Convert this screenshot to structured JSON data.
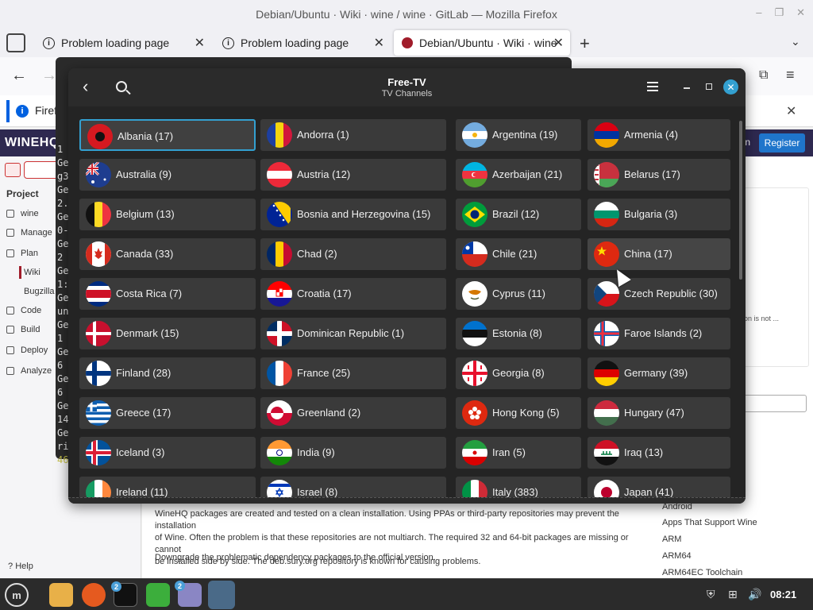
{
  "browser": {
    "window_title": "Debian/Ubuntu · Wiki · wine / wine · GitLab — Mozilla Firefox",
    "tabs": [
      {
        "label": "Problem loading page",
        "active": false
      },
      {
        "label": "Problem loading page",
        "active": false
      },
      {
        "label": "Debian/Ubuntu · Wiki · wine",
        "active": true
      }
    ],
    "notice_text": "Firef"
  },
  "gitlab": {
    "logo": "WINEHQ",
    "signin": "In",
    "register": "Register",
    "project_heading": "Project",
    "nav": [
      "wine",
      "Manage",
      "Plan",
      "Wiki",
      "Bugzilla",
      "Code",
      "Build",
      "Deploy",
      "Analyze"
    ],
    "help": "Help",
    "para1_line1": "WineHQ packages are created and tested on a clean installation. Using PPAs or third-party repositories may prevent the installation",
    "para1_line2": "of Wine. Often the problem is that these repositories are not multiarch. The required 32 and 64-bit packages are missing or cannot",
    "para1_line3": "be installed side by side. The deb.sury.org repository is known for causing problems.",
    "para2": "Downgrade the problematic dependency packages to the official version.",
    "card_text": "on is not ...",
    "right_links": [
      "Android",
      "Apps That Support Wine",
      "ARM",
      "ARM64",
      "ARM64EC Toolchain"
    ]
  },
  "terminal": {
    "chars": [
      "1",
      "Ge",
      "g3",
      "Ge",
      "2.",
      "Ge",
      "0-",
      "Ge",
      "2",
      "Ge",
      "1:",
      "Ge",
      "un",
      "Ge",
      "1",
      "Ge",
      "6",
      "Ge",
      "6",
      "Ge",
      "14",
      "Ge",
      "ri",
      "46"
    ]
  },
  "freetv": {
    "title": "Free-TV",
    "subtitle": "TV Channels",
    "selected": "Albania (17)",
    "hovered": "China (17)",
    "rows": [
      [
        "Albania (17)",
        "Andorra (1)",
        "Argentina (19)",
        "Armenia (4)"
      ],
      [
        "Australia (9)",
        "Austria (12)",
        "Azerbaijan (21)",
        "Belarus (17)"
      ],
      [
        "Belgium (13)",
        "Bosnia and Herzegovina (15)",
        "Brazil (12)",
        "Bulgaria (3)"
      ],
      [
        "Canada (33)",
        "Chad (2)",
        "Chile (21)",
        "China (17)"
      ],
      [
        "Costa Rica (7)",
        "Croatia (17)",
        "Cyprus (11)",
        "Czech Republic (30)"
      ],
      [
        "Denmark (15)",
        "Dominican Republic (1)",
        "Estonia (8)",
        "Faroe Islands (2)"
      ],
      [
        "Finland (28)",
        "France (25)",
        "Georgia (8)",
        "Germany (39)"
      ],
      [
        "Greece (17)",
        "Greenland (2)",
        "Hong Kong (5)",
        "Hungary (47)"
      ],
      [
        "Iceland (3)",
        "India (9)",
        "Iran (5)",
        "Iraq (13)"
      ],
      [
        "Ireland (11)",
        "Israel (8)",
        "Italy (383)",
        "Japan (41)"
      ]
    ],
    "flag_icons": [
      [
        "albania-flag-icon",
        "andorra-flag-icon",
        "argentina-flag-icon",
        "armenia-flag-icon"
      ],
      [
        "australia-flag-icon",
        "austria-flag-icon",
        "azerbaijan-flag-icon",
        "belarus-flag-icon"
      ],
      [
        "belgium-flag-icon",
        "bosnia-flag-icon",
        "brazil-flag-icon",
        "bulgaria-flag-icon"
      ],
      [
        "canada-flag-icon",
        "chad-flag-icon",
        "chile-flag-icon",
        "china-flag-icon"
      ],
      [
        "costa-rica-flag-icon",
        "croatia-flag-icon",
        "cyprus-flag-icon",
        "czech-flag-icon"
      ],
      [
        "denmark-flag-icon",
        "dominican-flag-icon",
        "estonia-flag-icon",
        "faroe-flag-icon"
      ],
      [
        "finland-flag-icon",
        "france-flag-icon",
        "georgia-flag-icon",
        "germany-flag-icon"
      ],
      [
        "greece-flag-icon",
        "greenland-flag-icon",
        "hong-kong-flag-icon",
        "hungary-flag-icon"
      ],
      [
        "iceland-flag-icon",
        "india-flag-icon",
        "iran-flag-icon",
        "iraq-flag-icon"
      ],
      [
        "ireland-flag-icon",
        "israel-flag-icon",
        "italy-flag-icon",
        "japan-flag-icon"
      ]
    ]
  },
  "taskbar": {
    "apps": [
      "files-icon",
      "firefox-icon",
      "terminal-icon",
      "shield-app-icon",
      "notes-icon",
      "freetv-icon"
    ],
    "badges": [
      "2",
      "2"
    ],
    "clock": "08:21"
  }
}
